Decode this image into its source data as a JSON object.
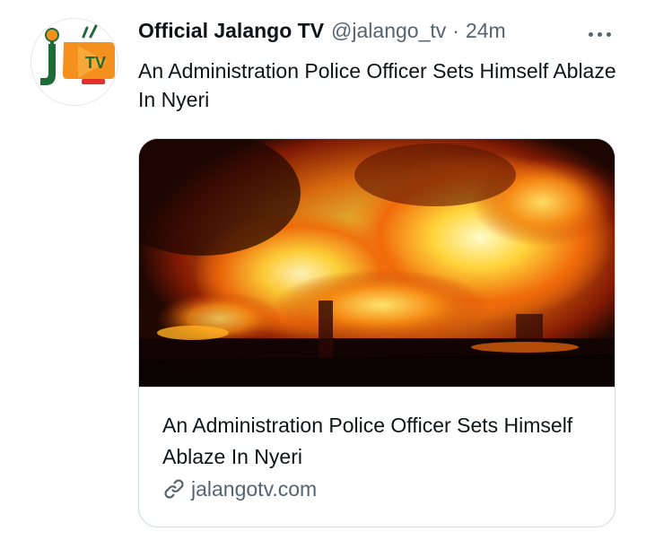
{
  "tweet": {
    "author": {
      "display_name": "Official Jalango TV",
      "handle": "@jalango_tv",
      "separator": "·",
      "time": "24m",
      "avatar_icon": "jalango-tv-logo-icon",
      "avatar_logo_text": "TV"
    },
    "text": "An Administration Police Officer Sets Himself Ablaze In Nyeri",
    "more_icon": "more-horizontal-icon",
    "card": {
      "image_icon": "fire-photo",
      "title": "An Administration Police Officer Sets Himself Ablaze In Nyeri",
      "domain_icon": "link-icon",
      "domain": "jalangotv.com"
    }
  },
  "colors": {
    "text_primary": "#0f1419",
    "text_secondary": "#536471",
    "border": "#cfd9de",
    "logo_green": "#1d6b36",
    "logo_orange": "#f4901e",
    "logo_red": "#e0312d"
  }
}
